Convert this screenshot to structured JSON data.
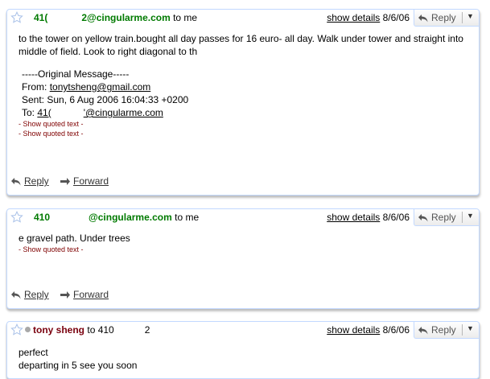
{
  "messages": [
    {
      "sender_prefix": "41(",
      "sender_suffix": "2@cingularme.com",
      "recipient": "to me",
      "show_details": "show details",
      "date": "8/6/06",
      "reply_label": "Reply",
      "body": "to the tower on yellow train.bought all day passes for 16 euro- all day. Walk under tower and straight into middle of field. Look to right diagonal to th",
      "original": {
        "header": "-----Original Message-----",
        "from_label": "From:",
        "from_value": "tonytsheng@gmail.com",
        "sent_label": "Sent:",
        "sent_value": "Sun, 6 Aug 2006 16:04:33 +0200",
        "to_label": "To:",
        "to_prefix": "41(",
        "to_suffix": "'@cingularme.com"
      },
      "quoted": [
        "- Show quoted text -",
        "- Show quoted text -"
      ],
      "footer": {
        "reply": "Reply",
        "forward": "Forward"
      }
    },
    {
      "sender_prefix": "410",
      "sender_suffix": "@cingularme.com",
      "recipient": "to me",
      "show_details": "show details",
      "date": "8/6/06",
      "reply_label": "Reply",
      "body": "e gravel path. Under trees",
      "quoted": [
        "- Show quoted text -"
      ],
      "footer": {
        "reply": "Reply",
        "forward": "Forward"
      }
    },
    {
      "sender_name": "tony sheng",
      "recipient_prefix": "to 410",
      "recipient_suffix": "2",
      "show_details": "show details",
      "date": "8/6/06",
      "reply_label": "Reply",
      "body_lines": [
        "perfect",
        "departing in 5 see you soon"
      ]
    }
  ],
  "colors": {
    "sender_green": "#007a00",
    "sender_red": "#79000e",
    "card_border": "#c3d9ff"
  }
}
